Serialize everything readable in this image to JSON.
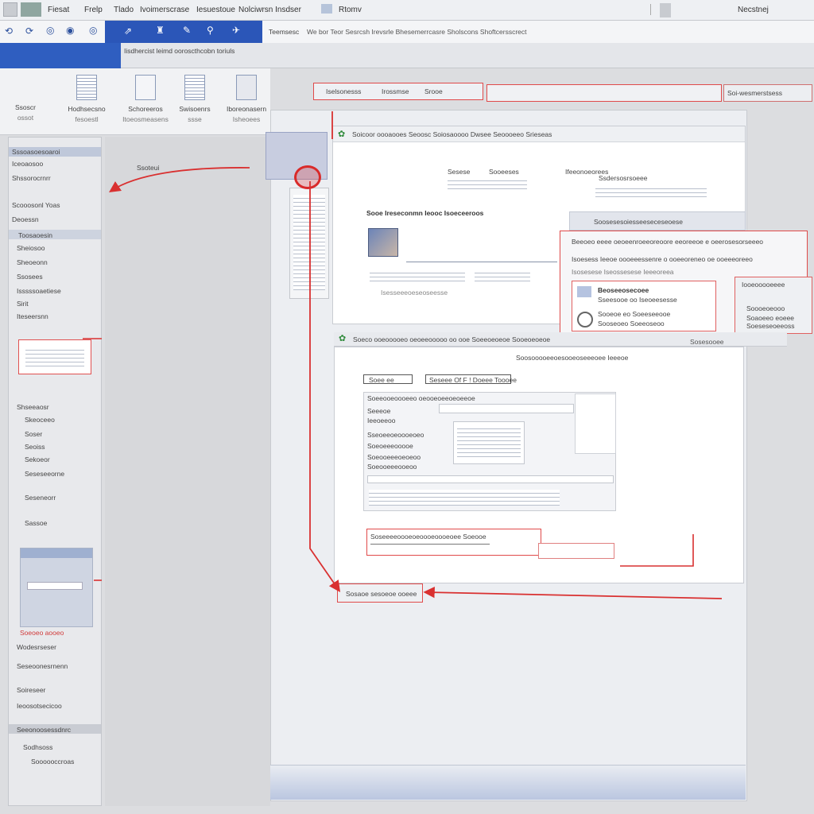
{
  "menu": {
    "items": [
      "Fiesat",
      "Frelp",
      "Tlado",
      "Ivoimerscrase",
      "Iesuestoue",
      "Nolciwrsn Insdser",
      "Rtomv"
    ],
    "right_label": "Necstnej"
  },
  "toolbar": {
    "text": "We bor Teor  Sesrcsh Irevsrle  Bhesemerrcasre  Sholscons  Shoftcersscrect",
    "left_label": "Teemsesc"
  },
  "header_strip": {
    "text": "Iisdhercist leimd ooroscthcobn toriuls"
  },
  "ribbon": {
    "buttons": [
      {
        "label": "Ssoscr",
        "sub": "ossot"
      },
      {
        "label": "Hodhsecsno",
        "sub": "fesoestl"
      },
      {
        "label": "Schoreeros",
        "sub": "Itoeosmeasens"
      },
      {
        "label": "Swisoenrs",
        "sub": "ssse"
      },
      {
        "label": "Iboreonasern",
        "sub": "Isheoees"
      }
    ]
  },
  "sidebar": {
    "items": [
      "Sssoasoesoaroi",
      "Iceoaosoo",
      "Shssorocrnrr",
      "Scooosonl Yoas",
      "Deoessn",
      "Toosaoesin",
      "Sheiosoo",
      "Sheoeonn",
      "Ssosees",
      "Isssssoaetiese",
      "Sirit",
      "Iteseersnn",
      "Shseeaosr",
      "Skeoceeo",
      "Soser",
      "Seoiss",
      "Sekoeor",
      "Seseseeorne",
      "Seseneorr",
      "Sassoe",
      "Wodesrseser",
      "Seseoonesrnenn",
      "Soireseer",
      "Ieoosotsecicoo",
      "Seeonoosessdnrc",
      "Sodhsoss",
      "Soooooccroas"
    ]
  },
  "callout_left": {
    "text": "Ssoteui"
  },
  "top_tabs": {
    "tab1": "Iselsonesss",
    "tab2": "Irossmse",
    "tab3": "Srooe",
    "right_text": "Soi-wesmerstsess"
  },
  "doc1": {
    "toolbar_text": "Soicoor oooaooes  Seoosc  Soiosaoooo  Dwsee  Seoooeeo  Srieseas",
    "heading": "Sooe Ireseconmn Ieooc Isoeceeroos",
    "col1": "Sesese",
    "col2": "Sooeeses",
    "col3": "Ifeeonoeorees",
    "col4": "Ssdersosrsoeee",
    "caption": "Isesseeeoeseoseesse"
  },
  "popup": {
    "title": "Soosesesoiesseeseceseoese",
    "line1": "Beeoeo eeee oeoeenroeeoreoore eeoreeoe e oeerosesorseeeo",
    "line2": "Isoesess Ieeoe oooeeessenre o ooeeoreneo oe ooeeeoreeo",
    "line3": "Isosesese  Iseossesese  Ieeeoreea",
    "inner_title": "Beoseeosecoee",
    "inner_l1": "Sseesooe oo  Iseoeesesse",
    "inner_l2": "Sooeoe eo  Soeeseeooe",
    "inner_l3": "Sooseoeo  Soeeoseoo"
  },
  "side_note": {
    "l1": "Iooeooooeeee",
    "l2": "Soooeoeooo",
    "l3": "Soaoeeo eoeee",
    "l4": "Soeseseoeeoss"
  },
  "doc2": {
    "toolbar_text": "Soeco ooeooooeo oeoeeooooo oo ooe  Soeeoeoeoe  Sooeoeoeoe",
    "right_label": "Sosesooee",
    "header": "Soosooooeeoesooeoseeeoee Ieeeoe",
    "btn1": "Soee ee",
    "btn2": "Seseee  Of  F ! Doeee  Toooee",
    "rows": [
      "Soeeooeoooeeo oeooeoeeoeoeeoe",
      "Seeeoe",
      "Ieeoeeoo",
      "Sseoeeoeoooeoeo",
      "Soeoeeeooooe",
      "Soeooeeeoeoeoo",
      "Soeooeeeooeoo"
    ],
    "highlight": "Soseeeeoooeoeoooeoooeoee  Soeooe"
  },
  "bottom_callout": {
    "text": "Sosaoe sesoeoe ooeee"
  },
  "sidebar_red": {
    "text": "Soeoeo aooeo"
  }
}
